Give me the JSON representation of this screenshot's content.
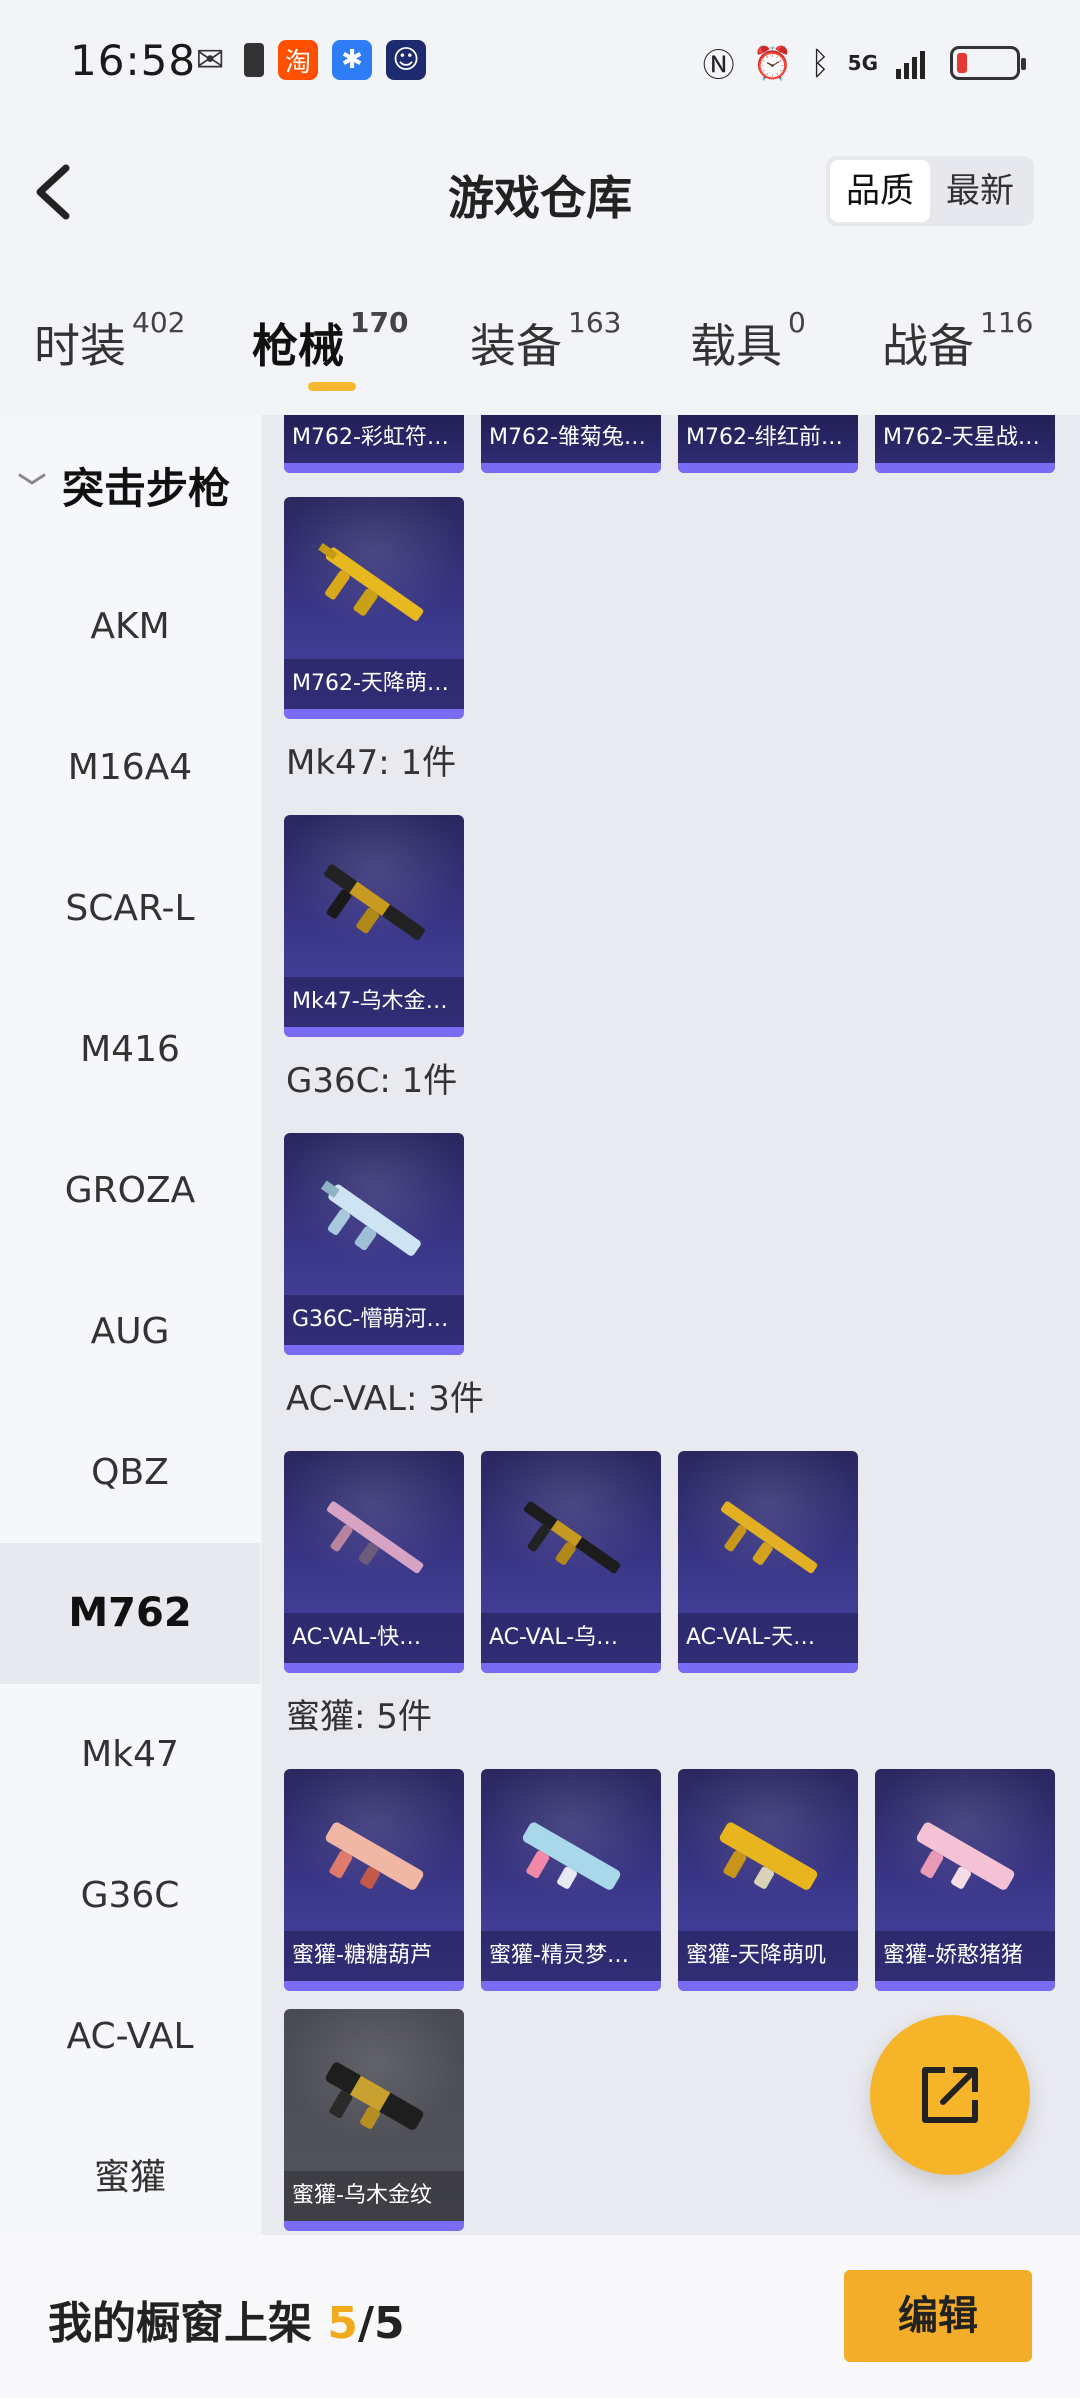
{
  "status_bar": {
    "time": "16:58",
    "network": "5G",
    "left_icons": [
      "wechat-icon",
      "battery-saver-icon",
      "taobao-icon",
      "app-icon",
      "robot-app-icon"
    ],
    "right_icons": [
      "nfc-icon",
      "alarm-icon",
      "bluetooth-icon",
      "signal-icon",
      "battery-icon"
    ],
    "battery_level": 0.12
  },
  "header": {
    "title": "游戏仓库",
    "sort_options": [
      "品质",
      "最新"
    ],
    "sort_selected": "品质"
  },
  "tabs": [
    {
      "label": "时装",
      "count": "402"
    },
    {
      "label": "枪械",
      "count": "170",
      "active": true
    },
    {
      "label": "装备",
      "count": "163"
    },
    {
      "label": "载具",
      "count": "0"
    },
    {
      "label": "战备",
      "count": "116"
    }
  ],
  "sidebar": {
    "category": "突击步枪",
    "items": [
      "AKM",
      "M16A4",
      "SCAR-L",
      "M416",
      "GROZA",
      "AUG",
      "QBZ",
      "M762",
      "Mk47",
      "G36C",
      "AC-VAL",
      "蜜獾"
    ],
    "selected": "M762"
  },
  "groups": [
    {
      "title": "",
      "items": [
        {
          "name": "M762-彩虹符…"
        },
        {
          "name": "M762-雏菊兔…"
        },
        {
          "name": "M762-绯红前…"
        },
        {
          "name": "M762-天星战…"
        }
      ]
    },
    {
      "title": "",
      "items": [
        {
          "name": "M762-天降萌…"
        }
      ]
    },
    {
      "title": "Mk47: 1件",
      "items": [
        {
          "name": "Mk47-乌木金…"
        }
      ]
    },
    {
      "title": "G36C: 1件",
      "items": [
        {
          "name": "G36C-懵萌河…"
        }
      ]
    },
    {
      "title": "AC-VAL: 3件",
      "items": [
        {
          "name": "AC-VAL-快…"
        },
        {
          "name": "AC-VAL-乌…"
        },
        {
          "name": "AC-VAL-天…"
        }
      ]
    },
    {
      "title": "蜜獾: 5件",
      "items": [
        {
          "name": "蜜獾-糖糖葫芦"
        },
        {
          "name": "蜜獾-精灵梦…"
        },
        {
          "name": "蜜獾-天降萌叽"
        },
        {
          "name": "蜜獾-娇憨猪猪"
        },
        {
          "name": "蜜獾-乌木金纹"
        }
      ]
    }
  ],
  "colors": {
    "accent": "#f5b82e",
    "card_bg": "#3b378a",
    "card_bar": "#7a6cf2"
  },
  "bottom_bar": {
    "label": "我的橱窗上架",
    "current": "5",
    "separator": "/",
    "total": "5",
    "edit_label": "编辑"
  }
}
